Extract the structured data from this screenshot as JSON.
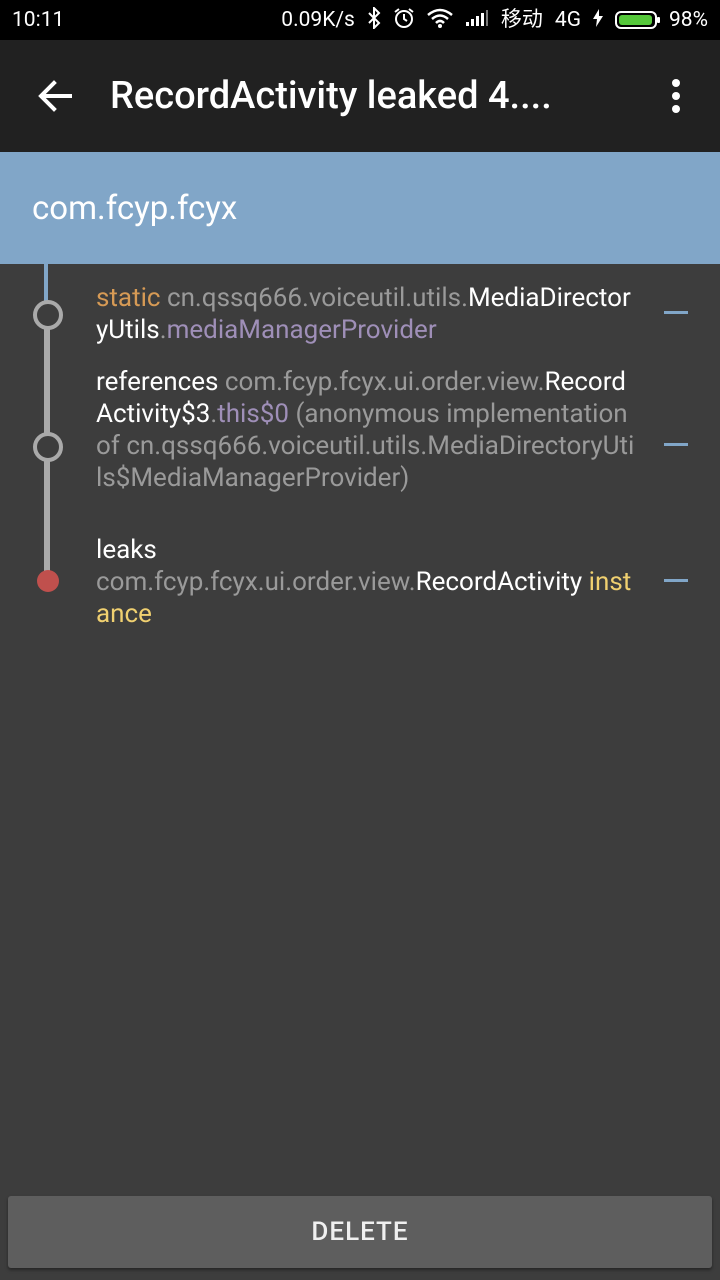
{
  "status_bar": {
    "time": "10:11",
    "net_speed": "0.09K/s",
    "carrier": "移动",
    "network": "4G",
    "battery": "98%",
    "battery_level": 0.98
  },
  "toolbar": {
    "title": "RecordActivity leaked 4...."
  },
  "header": {
    "package": "com.fcyp.fcyx"
  },
  "trace": [
    {
      "prefix": "static",
      "class_pre": "cn.qssq666.voiceutil.utils.",
      "class_name": "MediaDirectoryUtils",
      "dot": ".",
      "field": "mediaManagerProvider"
    },
    {
      "prefix": "references",
      "class_pre": "com.fcyp.fcyx.ui.order.view.",
      "class_name": "RecordActivity$3",
      "dot": ".",
      "field": "this$0",
      "extra": "(anonymous implementation of cn.qssq666.voiceutil.utils.MediaDirectoryUtils$MediaManagerProvider)"
    },
    {
      "prefix": "leaks",
      "class_pre": "com.fcyp.fcyx.ui.order.view.",
      "class_name": "RecordActivity",
      "suffix": "instance"
    }
  ],
  "footer": {
    "delete_label": "DELETE"
  },
  "colors": {
    "header_bg": "#81a6c8",
    "static_keyword": "#d69a55",
    "field": "#9f8fb8",
    "instance_keyword": "#f0d070",
    "leak_node": "#c0504d"
  }
}
